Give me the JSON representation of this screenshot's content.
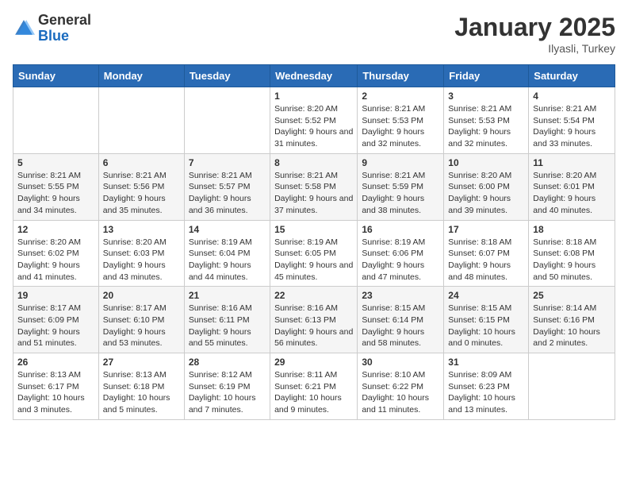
{
  "header": {
    "logo": {
      "general": "General",
      "blue": "Blue"
    },
    "title": "January 2025",
    "location": "Ilyasli, Turkey"
  },
  "weekdays": [
    "Sunday",
    "Monday",
    "Tuesday",
    "Wednesday",
    "Thursday",
    "Friday",
    "Saturday"
  ],
  "weeks": [
    [
      null,
      null,
      null,
      {
        "day": "1",
        "sunrise": "Sunrise: 8:20 AM",
        "sunset": "Sunset: 5:52 PM",
        "daylight": "Daylight: 9 hours and 31 minutes."
      },
      {
        "day": "2",
        "sunrise": "Sunrise: 8:21 AM",
        "sunset": "Sunset: 5:53 PM",
        "daylight": "Daylight: 9 hours and 32 minutes."
      },
      {
        "day": "3",
        "sunrise": "Sunrise: 8:21 AM",
        "sunset": "Sunset: 5:53 PM",
        "daylight": "Daylight: 9 hours and 32 minutes."
      },
      {
        "day": "4",
        "sunrise": "Sunrise: 8:21 AM",
        "sunset": "Sunset: 5:54 PM",
        "daylight": "Daylight: 9 hours and 33 minutes."
      }
    ],
    [
      {
        "day": "5",
        "sunrise": "Sunrise: 8:21 AM",
        "sunset": "Sunset: 5:55 PM",
        "daylight": "Daylight: 9 hours and 34 minutes."
      },
      {
        "day": "6",
        "sunrise": "Sunrise: 8:21 AM",
        "sunset": "Sunset: 5:56 PM",
        "daylight": "Daylight: 9 hours and 35 minutes."
      },
      {
        "day": "7",
        "sunrise": "Sunrise: 8:21 AM",
        "sunset": "Sunset: 5:57 PM",
        "daylight": "Daylight: 9 hours and 36 minutes."
      },
      {
        "day": "8",
        "sunrise": "Sunrise: 8:21 AM",
        "sunset": "Sunset: 5:58 PM",
        "daylight": "Daylight: 9 hours and 37 minutes."
      },
      {
        "day": "9",
        "sunrise": "Sunrise: 8:21 AM",
        "sunset": "Sunset: 5:59 PM",
        "daylight": "Daylight: 9 hours and 38 minutes."
      },
      {
        "day": "10",
        "sunrise": "Sunrise: 8:20 AM",
        "sunset": "Sunset: 6:00 PM",
        "daylight": "Daylight: 9 hours and 39 minutes."
      },
      {
        "day": "11",
        "sunrise": "Sunrise: 8:20 AM",
        "sunset": "Sunset: 6:01 PM",
        "daylight": "Daylight: 9 hours and 40 minutes."
      }
    ],
    [
      {
        "day": "12",
        "sunrise": "Sunrise: 8:20 AM",
        "sunset": "Sunset: 6:02 PM",
        "daylight": "Daylight: 9 hours and 41 minutes."
      },
      {
        "day": "13",
        "sunrise": "Sunrise: 8:20 AM",
        "sunset": "Sunset: 6:03 PM",
        "daylight": "Daylight: 9 hours and 43 minutes."
      },
      {
        "day": "14",
        "sunrise": "Sunrise: 8:19 AM",
        "sunset": "Sunset: 6:04 PM",
        "daylight": "Daylight: 9 hours and 44 minutes."
      },
      {
        "day": "15",
        "sunrise": "Sunrise: 8:19 AM",
        "sunset": "Sunset: 6:05 PM",
        "daylight": "Daylight: 9 hours and 45 minutes."
      },
      {
        "day": "16",
        "sunrise": "Sunrise: 8:19 AM",
        "sunset": "Sunset: 6:06 PM",
        "daylight": "Daylight: 9 hours and 47 minutes."
      },
      {
        "day": "17",
        "sunrise": "Sunrise: 8:18 AM",
        "sunset": "Sunset: 6:07 PM",
        "daylight": "Daylight: 9 hours and 48 minutes."
      },
      {
        "day": "18",
        "sunrise": "Sunrise: 8:18 AM",
        "sunset": "Sunset: 6:08 PM",
        "daylight": "Daylight: 9 hours and 50 minutes."
      }
    ],
    [
      {
        "day": "19",
        "sunrise": "Sunrise: 8:17 AM",
        "sunset": "Sunset: 6:09 PM",
        "daylight": "Daylight: 9 hours and 51 minutes."
      },
      {
        "day": "20",
        "sunrise": "Sunrise: 8:17 AM",
        "sunset": "Sunset: 6:10 PM",
        "daylight": "Daylight: 9 hours and 53 minutes."
      },
      {
        "day": "21",
        "sunrise": "Sunrise: 8:16 AM",
        "sunset": "Sunset: 6:11 PM",
        "daylight": "Daylight: 9 hours and 55 minutes."
      },
      {
        "day": "22",
        "sunrise": "Sunrise: 8:16 AM",
        "sunset": "Sunset: 6:13 PM",
        "daylight": "Daylight: 9 hours and 56 minutes."
      },
      {
        "day": "23",
        "sunrise": "Sunrise: 8:15 AM",
        "sunset": "Sunset: 6:14 PM",
        "daylight": "Daylight: 9 hours and 58 minutes."
      },
      {
        "day": "24",
        "sunrise": "Sunrise: 8:15 AM",
        "sunset": "Sunset: 6:15 PM",
        "daylight": "Daylight: 10 hours and 0 minutes."
      },
      {
        "day": "25",
        "sunrise": "Sunrise: 8:14 AM",
        "sunset": "Sunset: 6:16 PM",
        "daylight": "Daylight: 10 hours and 2 minutes."
      }
    ],
    [
      {
        "day": "26",
        "sunrise": "Sunrise: 8:13 AM",
        "sunset": "Sunset: 6:17 PM",
        "daylight": "Daylight: 10 hours and 3 minutes."
      },
      {
        "day": "27",
        "sunrise": "Sunrise: 8:13 AM",
        "sunset": "Sunset: 6:18 PM",
        "daylight": "Daylight: 10 hours and 5 minutes."
      },
      {
        "day": "28",
        "sunrise": "Sunrise: 8:12 AM",
        "sunset": "Sunset: 6:19 PM",
        "daylight": "Daylight: 10 hours and 7 minutes."
      },
      {
        "day": "29",
        "sunrise": "Sunrise: 8:11 AM",
        "sunset": "Sunset: 6:21 PM",
        "daylight": "Daylight: 10 hours and 9 minutes."
      },
      {
        "day": "30",
        "sunrise": "Sunrise: 8:10 AM",
        "sunset": "Sunset: 6:22 PM",
        "daylight": "Daylight: 10 hours and 11 minutes."
      },
      {
        "day": "31",
        "sunrise": "Sunrise: 8:09 AM",
        "sunset": "Sunset: 6:23 PM",
        "daylight": "Daylight: 10 hours and 13 minutes."
      },
      null
    ]
  ]
}
